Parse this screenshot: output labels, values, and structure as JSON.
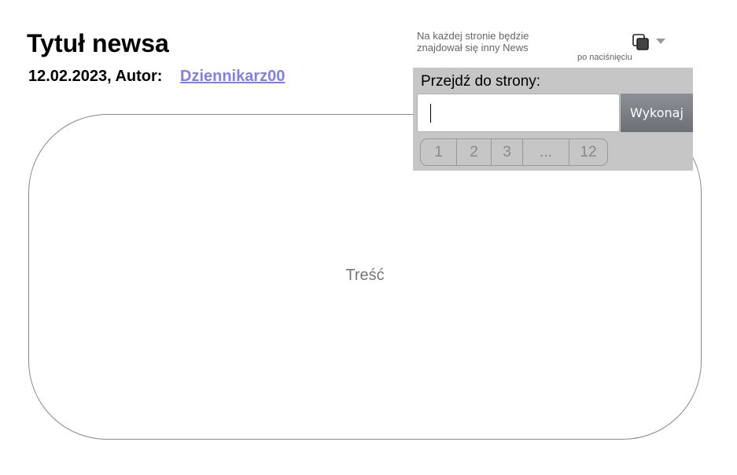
{
  "article": {
    "title": "Tytuł newsa",
    "meta": "12.02.2023, Autor:",
    "author": "Dziennikarz00",
    "content_placeholder": "Treść"
  },
  "note": {
    "line1": "Na każdej stronie będzie",
    "line2": "znajdował się inny News",
    "small": "po naciśnięciu"
  },
  "icons": {
    "copy": "copy-icon",
    "dropdown": "caret-down-icon"
  },
  "goto_panel": {
    "label": "Przejdź do strony:",
    "input_value": "",
    "button_label": "Wykonaj"
  },
  "pagination": {
    "pages": [
      "1",
      "2",
      "3",
      "...",
      "12"
    ]
  },
  "colors": {
    "link": "#8080e6",
    "panel_bg": "#c6c6c6",
    "button_bg": "#7c8085"
  }
}
